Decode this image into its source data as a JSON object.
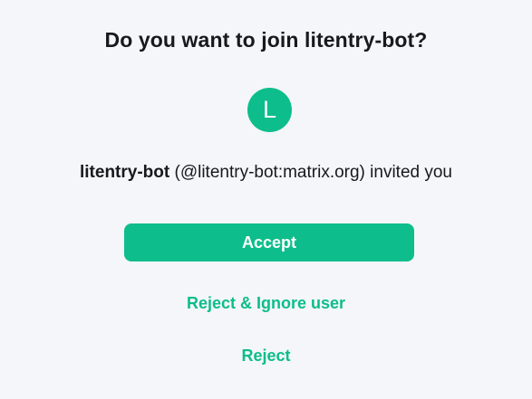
{
  "dialog": {
    "title": "Do you want to join litentry-bot?",
    "avatar_letter": "L",
    "inviter_name": "litentry-bot",
    "inviter_detail": " (@litentry-bot:matrix.org) invited you",
    "accept_label": "Accept",
    "reject_ignore_label": "Reject & Ignore user",
    "reject_label": "Reject"
  },
  "colors": {
    "accent": "#0dbd8b",
    "background": "#f4f6f9",
    "text": "#17191c"
  }
}
